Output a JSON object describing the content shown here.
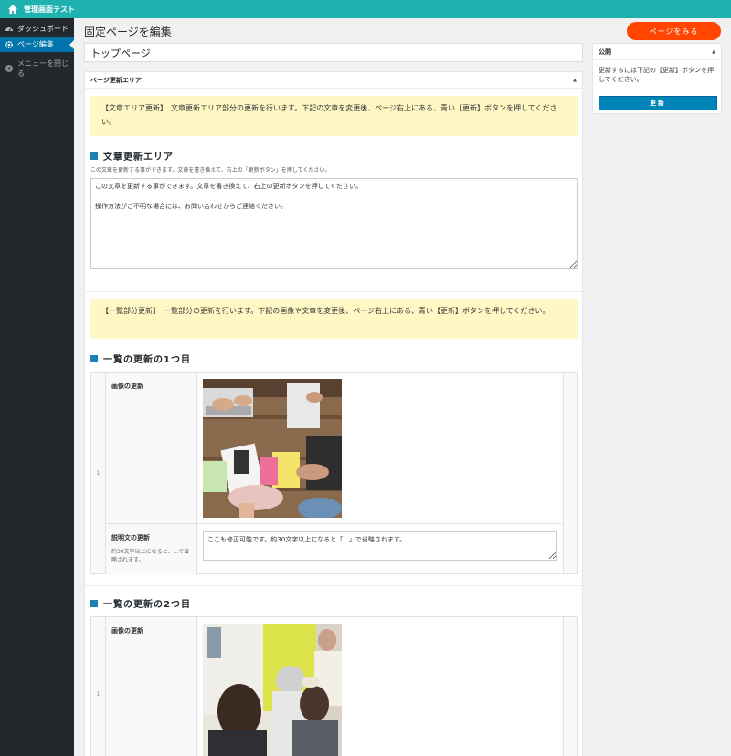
{
  "topbar": {
    "site_name": "管理画面テスト"
  },
  "sidebar": {
    "items": [
      {
        "label": "ダッシュボード"
      },
      {
        "label": "ページ編集"
      }
    ],
    "collapse_label": "メニューを閉じる"
  },
  "header": {
    "page_title": "固定ページを編集",
    "view_button": "ページをみる"
  },
  "title_input": {
    "value": "トップページ"
  },
  "metabox": {
    "title": "ページ更新エリア",
    "notice1": "【文章エリア更新】　文章更新エリア部分の更新を行います。下記の文章を変更後、ページ右上にある、青い【更新】ボタンを押してください。",
    "text_section": {
      "heading": "文章更新エリア",
      "description": "この文章を更新する事ができます。文章を書き換えて、右上の「更新ボタン」を押してください。",
      "textarea_value": "この文章を更新する事ができます。文章を書き換えて、右上の更新ボタンを押してください。\n\n操作方法がご不明な場合には、お問い合わせからご連絡ください。"
    },
    "notice2": "【一覧部分更新】　一覧部分の更新を行います。下記の画像や文章を変更後、ページ右上にある、青い【更新】ボタンを押してください。",
    "list_items": [
      {
        "heading": "一覧の更新の1つ目",
        "index": "1",
        "image_label": "画像の更新",
        "caption_label": "説明文の更新",
        "caption_note": "約30文字以上になると、...で省略されます。",
        "caption_value": "ここも修正可能です。約30文字以上になると「...」で省略されます。"
      },
      {
        "heading": "一覧の更新の2つ目",
        "index": "1",
        "image_label": "画像の更新"
      }
    ]
  },
  "publish": {
    "title": "公開",
    "text": "更新するには下記の【更新】ボタンを押してください。",
    "button": "更新"
  },
  "colors": {
    "topbar": "#1fb0b0",
    "sidebar": "#23282d",
    "accent_blue": "#0073aa",
    "view_button": "#ff4500",
    "notice_bg": "#fff8c5"
  }
}
